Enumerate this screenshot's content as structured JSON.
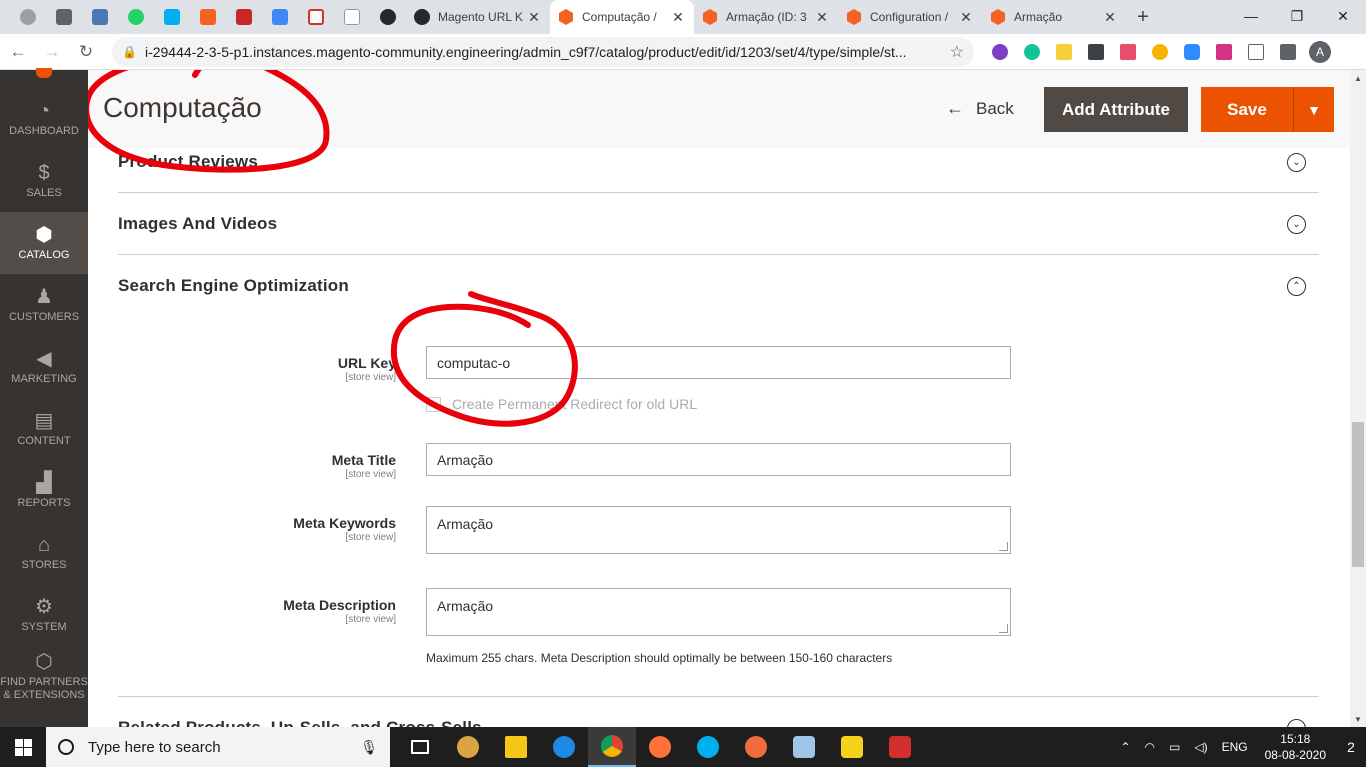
{
  "browser": {
    "tabs": [
      {
        "title": "Magento URL K",
        "favicon": "github-icon",
        "active": false
      },
      {
        "title": "Computação /",
        "favicon": "magento-icon",
        "active": true
      },
      {
        "title": "Armação (ID: 3",
        "favicon": "magento-icon",
        "active": false
      },
      {
        "title": "Configuration /",
        "favicon": "magento-icon",
        "active": false
      },
      {
        "title": "Armação",
        "favicon": "magento-icon",
        "active": false
      }
    ],
    "new_tab": "+",
    "url": "i-29444-2-3-5-p1.instances.magento-community.engineering/admin_c9f7/catalog/product/edit/id/1203/set/4/type/simple/st...",
    "profile_initial": "A"
  },
  "sidebar": {
    "items": [
      {
        "label": "DASHBOARD",
        "icon": "dashboard-icon"
      },
      {
        "label": "SALES",
        "icon": "dollar-icon"
      },
      {
        "label": "CATALOG",
        "icon": "box-icon"
      },
      {
        "label": "CUSTOMERS",
        "icon": "person-icon"
      },
      {
        "label": "MARKETING",
        "icon": "megaphone-icon"
      },
      {
        "label": "CONTENT",
        "icon": "layout-icon"
      },
      {
        "label": "REPORTS",
        "icon": "bar-chart-icon"
      },
      {
        "label": "STORES",
        "icon": "store-icon"
      },
      {
        "label": "SYSTEM",
        "icon": "gear-icon"
      },
      {
        "label": "FIND PARTNERS & EXTENSIONS",
        "icon": "partners-icon"
      }
    ]
  },
  "header": {
    "title": "Computação",
    "back_label": "Back",
    "add_attribute_label": "Add Attribute",
    "save_label": "Save"
  },
  "sections": {
    "product_reviews": "Product Reviews",
    "images_videos": "Images And Videos",
    "seo": "Search Engine Optimization",
    "related": "Related Products, Up-Sells, and Cross-Sells"
  },
  "seo_form": {
    "url_key": {
      "label": "URL Key",
      "scope": "[store view]",
      "value": "computac-o"
    },
    "redirect_checkbox_label": "Create Permanent Redirect for old URL",
    "meta_title": {
      "label": "Meta Title",
      "scope": "[store view]",
      "value": "Armação"
    },
    "meta_keywords": {
      "label": "Meta Keywords",
      "scope": "[store view]",
      "value": "Armação"
    },
    "meta_description": {
      "label": "Meta Description",
      "scope": "[store view]",
      "value": "Armação"
    },
    "meta_description_hint": "Maximum 255 chars. Meta Description should optimally be between 150-160 characters"
  },
  "taskbar": {
    "search_placeholder": "Type here to search",
    "language": "ENG",
    "time": "15:18",
    "date": "08-08-2020",
    "notifications": "2"
  },
  "colors": {
    "magento_orange": "#eb5202",
    "sidebar_bg": "#373330",
    "annotation_red": "#e8000b"
  }
}
